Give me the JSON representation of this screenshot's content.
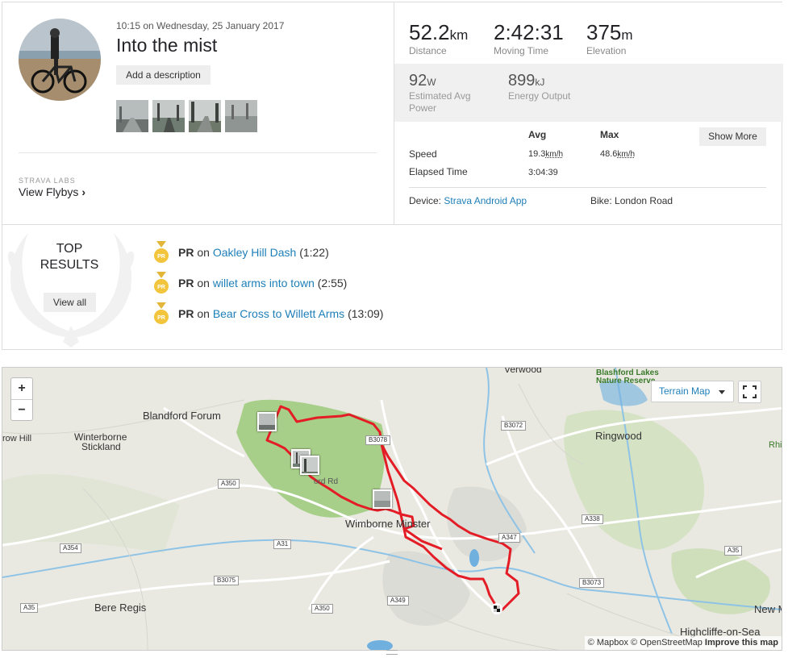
{
  "activity": {
    "datetime": "10:15 on Wednesday, 25 January 2017",
    "title": "Into the mist",
    "add_description": "Add a description",
    "labs_label": "STRAVA LABS",
    "flybys_label": "View Flybys"
  },
  "stats": {
    "distance": {
      "value": "52.2",
      "unit": "km",
      "label": "Distance"
    },
    "moving_time": {
      "value": "2:42:31",
      "label": "Moving Time"
    },
    "elevation": {
      "value": "375",
      "unit": "m",
      "label": "Elevation"
    },
    "power": {
      "value": "92",
      "unit": "W",
      "label1": "Estimated Avg",
      "label2": "Power"
    },
    "energy": {
      "value": "899",
      "unit": "kJ",
      "label": "Energy Output"
    }
  },
  "more": {
    "avg_header": "Avg",
    "max_header": "Max",
    "show_more": "Show More",
    "speed_label": "Speed",
    "speed_avg": "19.3",
    "speed_max": "48.6",
    "speed_unit": "km/h",
    "elapsed_label": "Elapsed Time",
    "elapsed_value": "3:04:39",
    "device_label": "Device:",
    "device_value": "Strava Android App",
    "bike_label": "Bike:",
    "bike_value": "London Road"
  },
  "results": {
    "top_line1": "TOP",
    "top_line2": "RESULTS",
    "view_all": "View all",
    "items": [
      {
        "prefix": "PR",
        "on": "on",
        "segment": "Oakley Hill Dash",
        "time": "(1:22)"
      },
      {
        "prefix": "PR",
        "on": "on",
        "segment": "willet arms into town",
        "time": "(2:55)"
      },
      {
        "prefix": "PR",
        "on": "on",
        "segment": "Bear Cross to Willett Arms",
        "time": "(13:09)"
      }
    ]
  },
  "map": {
    "zoom_in": "+",
    "zoom_out": "−",
    "terrain_label": "Terrain Map",
    "attribution_mapbox": "© Mapbox",
    "attribution_osm": "© OpenStreetMap",
    "attribution_improve": "Improve this map",
    "places": {
      "blandford": "Blandford Forum",
      "winterborne1": "Winterborne",
      "winterborne2": "Stickland",
      "ringwood": "Ringwood",
      "wimborne": "Wimborne Minster",
      "bere_regis": "Bere Regis",
      "verwood": "Verwood",
      "blashford1": "Blashford Lakes",
      "blashford2": "Nature Reserve",
      "highcliffe": "Highcliffe-on-Sea",
      "new_m": "New M",
      "row_hill": "row Hill",
      "rhi": "Rhi",
      "ord_rd": "ord Rd"
    },
    "roads": {
      "b3078": "B3078",
      "b3072": "B3072",
      "a350a": "A350",
      "a354": "A354",
      "a31": "A31",
      "b3075": "B3075",
      "a35a": "A35",
      "a350b": "A350",
      "a349": "A349",
      "a347": "A347",
      "a338": "A338",
      "a35b": "A35",
      "b3073": "B3073"
    }
  }
}
